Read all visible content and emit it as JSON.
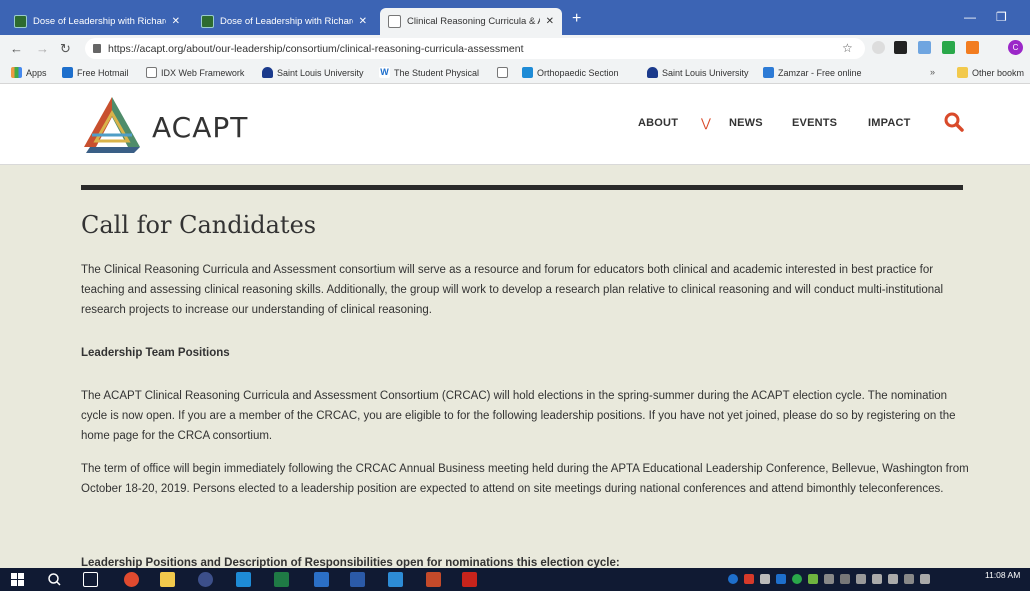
{
  "browser": {
    "tabs": [
      {
        "title": "Dose of Leadership with Richard",
        "active": false
      },
      {
        "title": "Dose of Leadership with Richard",
        "active": false
      },
      {
        "title": "Clinical Reasoning Curricula & As",
        "active": true
      }
    ],
    "new_tab": "+",
    "url": "https://acapt.org/about/our-leadership/consortium/clinical-reasoning-curricula-assessment",
    "profile_initial": "C"
  },
  "bookmarks": [
    {
      "label": "Apps"
    },
    {
      "label": "Free Hotmail"
    },
    {
      "label": "IDX Web Framework"
    },
    {
      "label": "Saint Louis University"
    },
    {
      "label": "The Student Physical"
    },
    {
      "label": "Orthopaedic Section"
    },
    {
      "label": "Saint Louis University"
    },
    {
      "label": "Zamzar - Free online"
    },
    {
      "label": "Other bookm"
    }
  ],
  "bookmarks_overflow": "»",
  "site": {
    "logo_text": "ACAPT",
    "nav": {
      "about": "ABOUT",
      "news": "NEWS",
      "events": "EVENTS",
      "impact": "IMPACT"
    }
  },
  "content": {
    "heading": "Call for Candidates",
    "intro": "The Clinical Reasoning Curricula and Assessment consortium will serve as a resource and forum for educators both clinical and academic interested in best practice for teaching and assessing clinical reasoning skills. Additionally, the group will work to develop a research plan relative to clinical reasoning and will conduct multi-institutional research projects to increase our understanding of clinical reasoning.",
    "section1_heading": "Leadership Team Positions",
    "para2": "The ACAPT Clinical Reasoning Curricula and Assessment Consortium (CRCAC) will hold elections in the spring-summer during the ACAPT election cycle.  The nomination cycle is now open.  If you are a member of the CRCAC, you are eligible to for the following leadership positions.  If you have not yet joined, please do so by registering on the home page for the CRCA consortium.",
    "para3": "The term of office will begin immediately following the CRCAC Annual Business meeting held during the APTA Educational Leadership Conference, Bellevue, Washington from October 18-20, 2019.  Persons elected to a leadership position are expected to attend on site meetings during national conferences and attend bimonthly teleconferences.",
    "section2_heading": "Leadership Positions and Description of Responsibilities open for nominations this election cycle:"
  },
  "taskbar": {
    "time": "11:08 AM"
  },
  "colors": {
    "tab_bar": "#3c64b4",
    "page_bg": "#e9e9dc",
    "accent": "#d94a2a",
    "taskbar": "#101a33"
  }
}
